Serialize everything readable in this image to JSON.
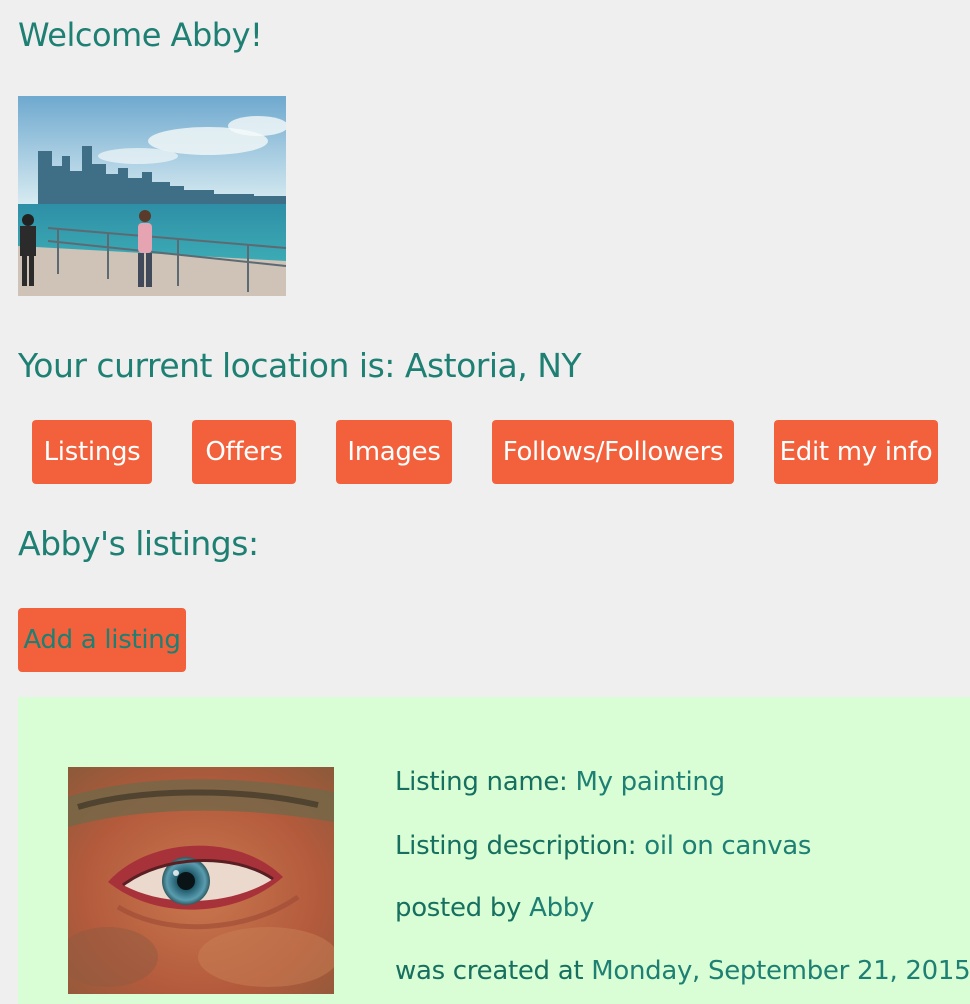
{
  "welcome": "Welcome Abby!",
  "location_text": "Your current location is: Astoria, NY",
  "nav": {
    "listings": "Listings",
    "offers": "Offers",
    "images": "Images",
    "follows": "Follows/Followers",
    "edit": "Edit my info"
  },
  "listings_heading": "Abby's listings:",
  "add_listing": "Add a listing",
  "listing": {
    "name_label": "Listing name:",
    "name": "My painting",
    "description_label": "Listing description:",
    "description": "oil on canvas",
    "posted_by_label": "posted by",
    "posted_by": "Abby",
    "created_label": "was created at",
    "created": "Monday, September 21, 2015"
  },
  "colors": {
    "accent": "#f2613c",
    "text": "#1e7f73",
    "background": "#efefef",
    "card": "#d9fed6"
  }
}
